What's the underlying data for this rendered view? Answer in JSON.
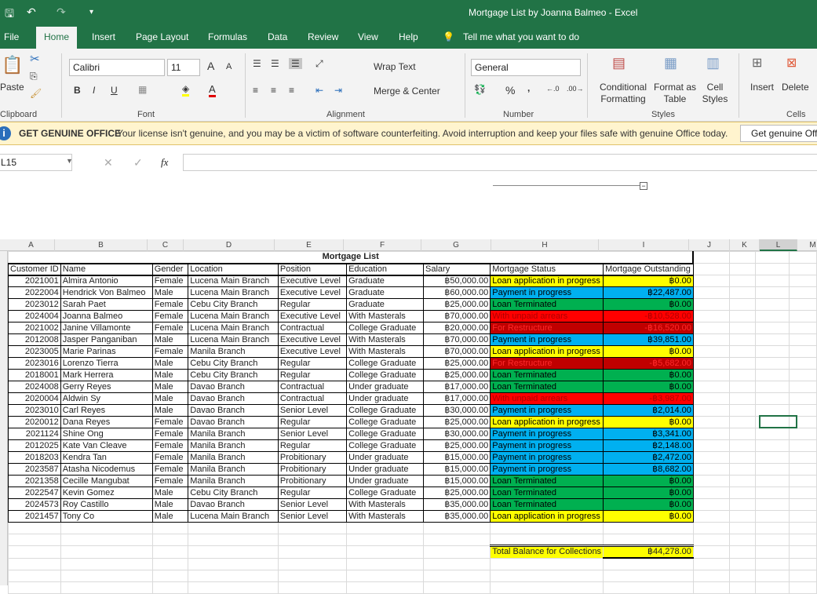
{
  "window": {
    "title": "Mortgage List by Joanna Balmeo  -  Excel"
  },
  "tabs": [
    "File",
    "Home",
    "Insert",
    "Page Layout",
    "Formulas",
    "Data",
    "Review",
    "View",
    "Help"
  ],
  "tell_me": "Tell me what you want to do",
  "ribbon": {
    "clipboard": {
      "paste": "Paste",
      "label": "Clipboard"
    },
    "font": {
      "name": "Calibri",
      "size": "11",
      "label": "Font",
      "bold": "B",
      "italic": "I",
      "underline": "U"
    },
    "alignment": {
      "wrap_text": "Wrap Text",
      "merge_center": "Merge & Center",
      "label": "Alignment"
    },
    "number": {
      "format": "General",
      "percent": "%",
      "comma": ",",
      "label": "Number"
    },
    "styles": {
      "conditional": "Conditional Formatting",
      "format_table": "Format as Table",
      "cell_styles": "Cell Styles",
      "label": "Styles"
    },
    "cells": {
      "insert": "Insert",
      "delete": "Delete",
      "label": "Cells"
    }
  },
  "infobar": {
    "title": "GET GENUINE OFFICE",
    "message": "Your license isn't genuine, and you may be a victim of software counterfeiting. Avoid interruption and keep your files safe with genuine Office today.",
    "button": "Get genuine Office"
  },
  "formula_bar": {
    "name_box": "L15",
    "fx": "fx",
    "value": ""
  },
  "columns": [
    "A",
    "B",
    "C",
    "D",
    "E",
    "F",
    "G",
    "H",
    "I",
    "J",
    "K",
    "L",
    "M"
  ],
  "sheet": {
    "title": "Mortgage List",
    "headers": [
      "Customer ID",
      "Name",
      "Gender",
      "Location",
      "Position",
      "Education",
      "Salary",
      "Mortgage Status",
      "Mortgage Outstanding"
    ],
    "status_colors": {
      "Loan application in progress": "#ffff00",
      "Payment in progress": "#00b0f0",
      "Loan Terminated": "#00b050",
      "With unpaid arrears": "#ff0000",
      "For Restructure": "#c00000"
    },
    "rows": [
      [
        "2021001",
        "Almira Antonio",
        "Female",
        "Lucena Main Branch",
        "Executive Level",
        "Graduate",
        "฿50,000.00",
        "Loan application in progress",
        "฿0.00"
      ],
      [
        "2022004",
        "Hendrick Von Balmeo",
        "Male",
        "Lucena Main Branch",
        "Executive Level",
        "Graduate",
        "฿60,000.00",
        "Payment in progress",
        "฿22,487.00"
      ],
      [
        "2023012",
        "Sarah Paet",
        "Female",
        "Cebu City Branch",
        "Regular",
        "Graduate",
        "฿25,000.00",
        "Loan Terminated",
        "฿0.00"
      ],
      [
        "2024004",
        "Joanna Balmeo",
        "Female",
        "Lucena Main Branch",
        "Executive Level",
        "With Masterals",
        "฿70,000.00",
        "With unpaid arrears",
        "-฿10,528.00"
      ],
      [
        "2021002",
        "Janine Villamonte",
        "Female",
        "Lucena Main Branch",
        "Contractual",
        "College Graduate",
        "฿20,000.00",
        "For Restructure",
        "-฿16,520.00"
      ],
      [
        "2012008",
        "Jasper Panganiban",
        "Male",
        "Lucena Main Branch",
        "Executive Level",
        "With Masterals",
        "฿70,000.00",
        "Payment in progress",
        "฿39,851.00"
      ],
      [
        "2023005",
        "Marie Parinas",
        "Female",
        "Manila Branch",
        "Executive Level",
        "With Masterals",
        "฿70,000.00",
        "Loan application in progress",
        "฿0.00"
      ],
      [
        "2023016",
        "Lorenzo Tierra",
        "Male",
        "Cebu City Branch",
        "Regular",
        "College Graduate",
        "฿25,000.00",
        "For Restructure",
        "-฿5,682.00"
      ],
      [
        "2018001",
        "Mark Herrera",
        "Male",
        "Cebu City Branch",
        "Regular",
        "College Graduate",
        "฿25,000.00",
        "Loan Terminated",
        "฿0.00"
      ],
      [
        "2024008",
        "Gerry Reyes",
        "Male",
        "Davao Branch",
        "Contractual",
        "Under graduate",
        "฿17,000.00",
        "Loan Terminated",
        "฿0.00"
      ],
      [
        "2020004",
        "Aldwin Sy",
        "Male",
        "Davao Branch",
        "Contractual",
        "Under graduate",
        "฿17,000.00",
        "With unpaid arrears",
        "-฿3,987.00"
      ],
      [
        "2023010",
        "Carl Reyes",
        "Male",
        "Davao Branch",
        "Senior Level",
        "College Graduate",
        "฿30,000.00",
        "Payment in progress",
        "฿2,014.00"
      ],
      [
        "2020012",
        "Dana Reyes",
        "Female",
        "Davao Branch",
        "Regular",
        "College Graduate",
        "฿25,000.00",
        "Loan application in progress",
        "฿0.00"
      ],
      [
        "2021124",
        "Shine Ong",
        "Female",
        "Manila Branch",
        "Senior Level",
        "College Graduate",
        "฿30,000.00",
        "Payment in progress",
        "฿3,341.00"
      ],
      [
        "2012025",
        "Kate Van Cleave",
        "Female",
        "Manila Branch",
        "Regular",
        "College Graduate",
        "฿25,000.00",
        "Payment in progress",
        "฿2,148.00"
      ],
      [
        "2018203",
        "Kendra Tan",
        "Female",
        "Manila Branch",
        "Probitionary",
        "Under graduate",
        "฿15,000.00",
        "Payment in progress",
        "฿2,472.00"
      ],
      [
        "2023587",
        "Atasha Nicodemus",
        "Female",
        "Manila Branch",
        "Probitionary",
        "Under graduate",
        "฿15,000.00",
        "Payment in progress",
        "฿8,682.00"
      ],
      [
        "2021358",
        "Cecille Mangubat",
        "Female",
        "Manila Branch",
        "Probitionary",
        "Under graduate",
        "฿15,000.00",
        "Loan Terminated",
        "฿0.00"
      ],
      [
        "2022547",
        "Kevin Gomez",
        "Male",
        "Cebu City Branch",
        "Regular",
        "College Graduate",
        "฿25,000.00",
        "Loan Terminated",
        "฿0.00"
      ],
      [
        "2024573",
        "Roy Castillo",
        "Male",
        "Davao Branch",
        "Senior Level",
        "With Masterals",
        "฿35,000.00",
        "Loan Terminated",
        "฿0.00"
      ],
      [
        "2021457",
        "Tony Co",
        "Male",
        "Lucena Main Branch",
        "Senior Level",
        "With Masterals",
        "฿35,000.00",
        "Loan application in progress",
        "฿0.00"
      ]
    ],
    "total_label": "Total Balance for Collections",
    "total_value": "฿44,278.00"
  }
}
